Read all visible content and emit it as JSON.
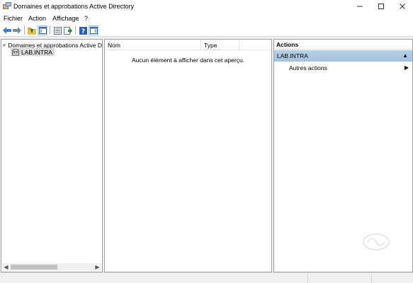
{
  "window": {
    "title": "Domaines et approbations Active Directory",
    "minimize_icon": "minimize-icon",
    "maximize_icon": "maximize-icon",
    "close_icon": "close-icon"
  },
  "menu": {
    "items": [
      "Fichier",
      "Action",
      "Affichage",
      "?"
    ]
  },
  "toolbar": {
    "icons": [
      "back-arrow-icon",
      "forward-arrow-icon",
      "folder-up-icon",
      "show-hide-console-tree-icon",
      "properties-icon",
      "export-list-icon",
      "help-icon",
      "show-hide-action-pane-icon"
    ]
  },
  "tree": {
    "root_label": "Domaines et approbations Active D",
    "child_label": "LAB.INTRA"
  },
  "list": {
    "columns": [
      "Nom",
      "Type"
    ],
    "empty_message": "Aucun élément à afficher dans cet aperçu."
  },
  "actions": {
    "header": "Actions",
    "section_title": "LAB.INTRA",
    "items": [
      "Autres actions"
    ]
  },
  "colors": {
    "section_background": "#a9c6e1",
    "selected_tree_item": "#d9d9d9"
  }
}
